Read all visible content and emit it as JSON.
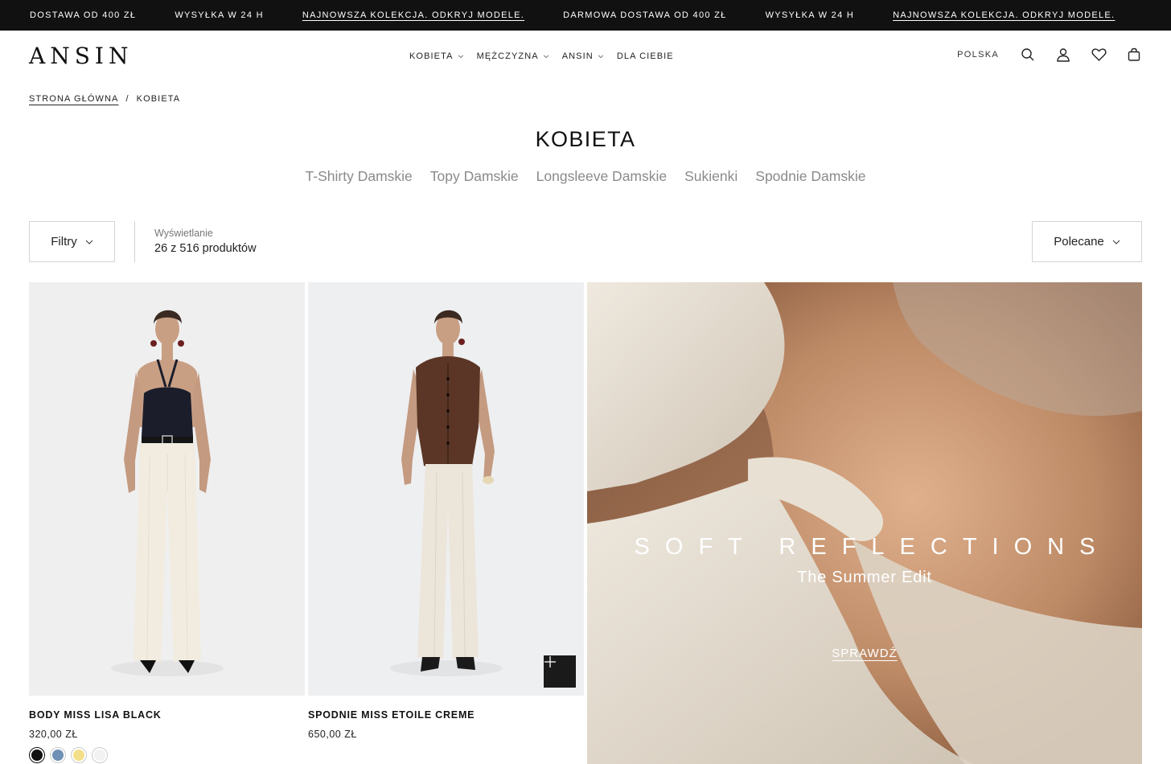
{
  "announcement": {
    "items": [
      {
        "text": "DOSTAWA OD 400 ZŁ",
        "link": false
      },
      {
        "text": "WYSYŁKA W 24 H",
        "link": false
      },
      {
        "text": "NAJNOWSZA KOLEKCJA. ODKRYJ MODELE.",
        "link": true
      },
      {
        "text": "DARMOWA DOSTAWA OD 400 ZŁ",
        "link": false
      },
      {
        "text": "WYSYŁKA W 24 H",
        "link": false
      },
      {
        "text": "NAJNOWSZA KOLEKCJA. ODKRYJ MODELE.",
        "link": true
      }
    ]
  },
  "header": {
    "logo": "ANSIN",
    "nav": [
      {
        "label": "KOBIETA",
        "has_dropdown": true
      },
      {
        "label": "MĘŻCZYZNA",
        "has_dropdown": true
      },
      {
        "label": "ANSIN",
        "has_dropdown": true
      },
      {
        "label": "DLA CIEBIE",
        "has_dropdown": false
      }
    ],
    "country": "POLSKA",
    "icons": [
      "search-icon",
      "account-icon",
      "wishlist-icon",
      "cart-icon"
    ]
  },
  "breadcrumb": {
    "home": "STRONA GŁÓWNA",
    "separator": "/",
    "current": "KOBIETA"
  },
  "page": {
    "title": "KOBIETA",
    "subcategories": [
      "T-Shirty Damskie",
      "Topy Damskie",
      "Longsleeve Damskie",
      "Sukienki",
      "Spodnie Damskie"
    ]
  },
  "toolbar": {
    "filter_label": "Filtry",
    "display_label": "Wyświetlanie",
    "display_count": "26 z 516 produktów",
    "sort_label": "Polecane"
  },
  "products": [
    {
      "name": "BODY MISS LISA BLACK",
      "price": "320,00 ZŁ",
      "swatches": [
        "#111111",
        "#6f8fb4",
        "#f3df8a",
        "#f2f2f2"
      ],
      "active_swatch": 0
    },
    {
      "name": "SPODNIE MISS ETOILE CREME",
      "price": "650,00 ZŁ",
      "swatches": [],
      "quick_add_icon": "plus-icon"
    }
  ],
  "banner": {
    "title": "SOFT REFLECTIONS",
    "subtitle": "The Summer Edit",
    "cta": "SPRAWDŹ"
  },
  "colors": {
    "announcement_bg": "#111111",
    "accent": "#111111",
    "muted_text": "#8a8a8a",
    "border": "#d4d4d4"
  }
}
